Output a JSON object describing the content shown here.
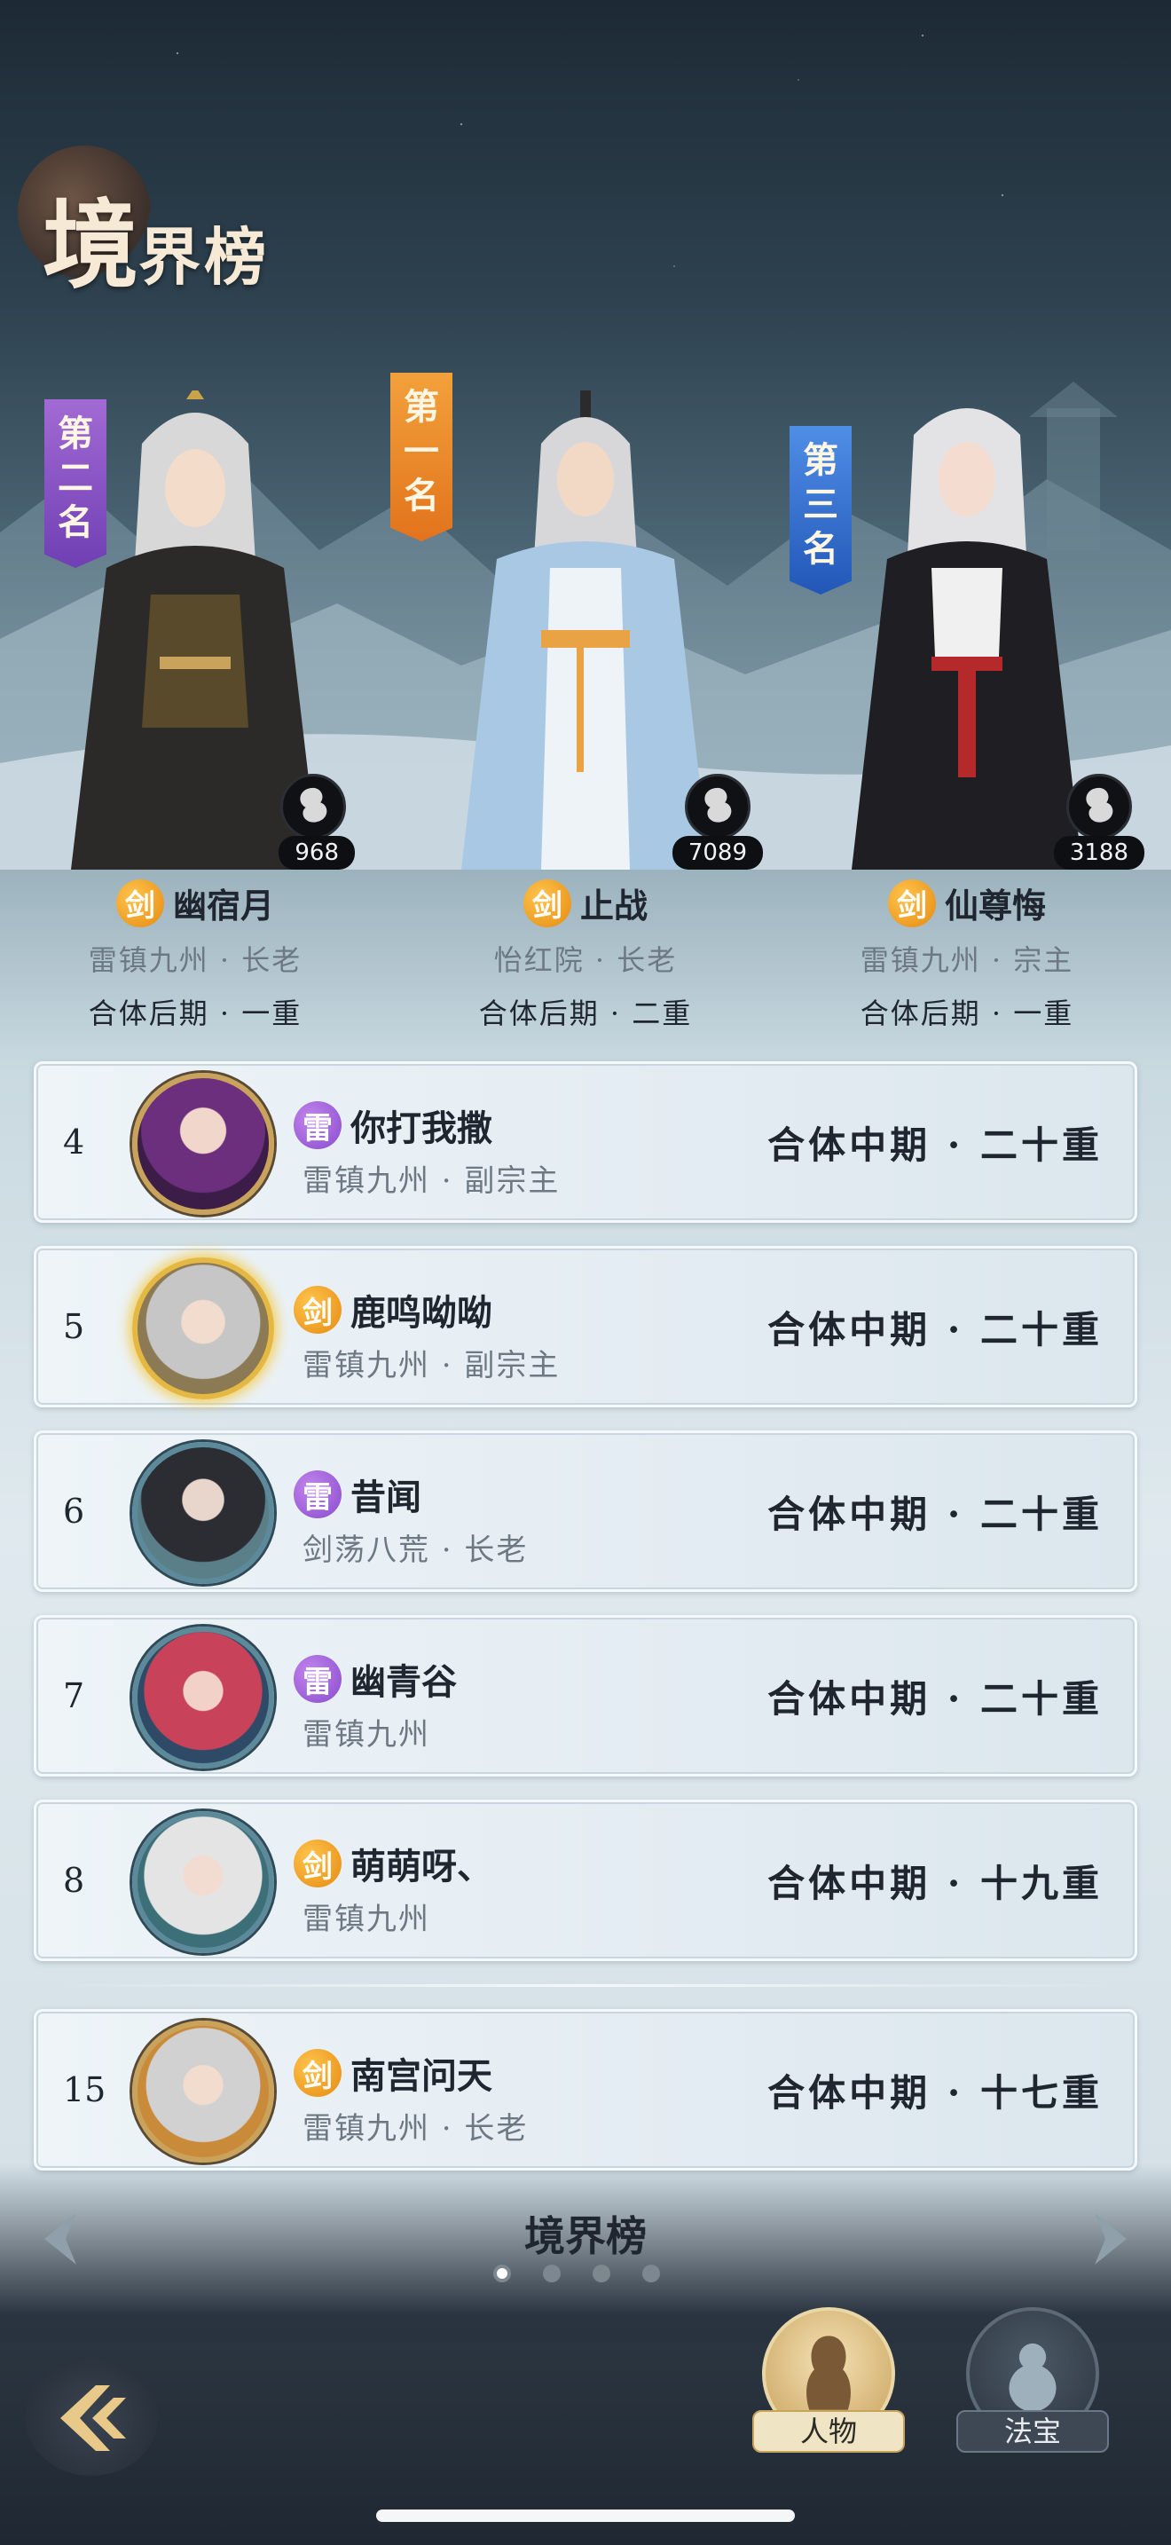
{
  "header": {
    "title_big": "境",
    "title_small": "界榜"
  },
  "podium": [
    {
      "position": "left",
      "rank_chars": [
        "第",
        "二",
        "名"
      ],
      "banner_color": "#8a55c8",
      "score": "968",
      "element": "剑",
      "name": "幽宿月",
      "guild": "雷镇九州 · 长老",
      "realm": "合体后期 · 一重"
    },
    {
      "position": "center",
      "rank_chars": [
        "第",
        "一",
        "名"
      ],
      "banner_color": "#ea8a25",
      "score": "7089",
      "element": "剑",
      "name": "止战",
      "guild": "怡红院 · 长老",
      "realm": "合体后期 · 二重"
    },
    {
      "position": "right",
      "rank_chars": [
        "第",
        "三",
        "名"
      ],
      "banner_color": "#3571d0",
      "score": "3188",
      "element": "剑",
      "name": "仙尊悔",
      "guild": "雷镇九州 · 宗主",
      "realm": "合体后期 · 一重"
    }
  ],
  "rows": [
    {
      "rank": "4",
      "element": "雷",
      "name": "你打我撒",
      "guild": "雷镇九州 · 副宗主",
      "realm": "合体中期 · 二十重"
    },
    {
      "rank": "5",
      "element": "剑",
      "name": "鹿鸣呦呦",
      "guild": "雷镇九州 · 副宗主",
      "realm": "合体中期 · 二十重"
    },
    {
      "rank": "6",
      "element": "雷",
      "name": "昔闻",
      "guild": "剑荡八荒 · 长老",
      "realm": "合体中期 · 二十重"
    },
    {
      "rank": "7",
      "element": "雷",
      "name": "幽青谷",
      "guild": "雷镇九州",
      "realm": "合体中期 · 二十重"
    },
    {
      "rank": "8",
      "element": "剑",
      "name": "萌萌呀、",
      "guild": "雷镇九州",
      "realm": "合体中期 · 十九重"
    }
  ],
  "self_row": {
    "rank": "15",
    "element": "剑",
    "name": "南宫问天",
    "guild": "雷镇九州 · 长老",
    "realm": "合体中期 · 十七重"
  },
  "pager": {
    "title": "境界榜",
    "page_count": 4,
    "current_page": 1
  },
  "nav": {
    "character_label": "人物",
    "treasure_label": "法宝"
  },
  "colors": {
    "element_sword": "#e8911a",
    "element_thunder": "#9456d1"
  }
}
